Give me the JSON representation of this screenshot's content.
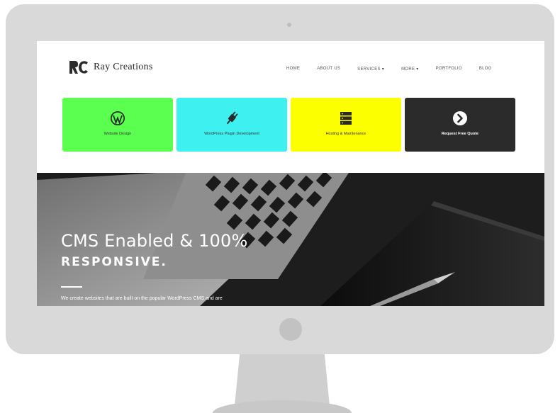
{
  "brand": {
    "name": "Ray Creations"
  },
  "nav": {
    "items": [
      "Home",
      "About Us",
      "Services ▾",
      "More ▾",
      "Portfolio",
      "Blog"
    ]
  },
  "tiles": [
    {
      "label": "Website Design",
      "icon": "wordpress-icon",
      "color": "#5bff4f"
    },
    {
      "label": "WordPress Plugin Development",
      "icon": "plug-icon",
      "color": "#3ff0f0"
    },
    {
      "label": "Hosting & Maintenance",
      "icon": "server-icon",
      "color": "#fbff00"
    },
    {
      "label": "Request Free Quote",
      "icon": "arrow-right-circle-icon",
      "color": "#2b2b2b"
    }
  ],
  "hero": {
    "title": "CMS Enabled & 100%",
    "subtitle": "RESPONSIVE.",
    "description": "We create websites that are built on the popular WordPress CMS and are"
  },
  "colors": {
    "monitor_frame": "#d9d9d9",
    "hero_bg": "#1f1f1f"
  }
}
